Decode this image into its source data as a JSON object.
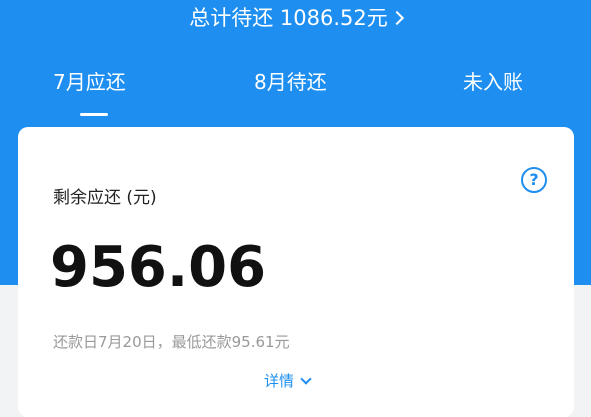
{
  "header": {
    "total_label": "总计待还",
    "total_amount": "1086.52元"
  },
  "tabs": [
    {
      "label": "7月应还",
      "active": true
    },
    {
      "label": "8月待还",
      "active": false
    },
    {
      "label": "未入账",
      "active": false
    }
  ],
  "card": {
    "label": "剩余应还 (元)",
    "help_glyph": "?",
    "amount": "956.06",
    "due_info": "还款日7月20日，最低还款95.61元",
    "details_label": "详情"
  },
  "colors": {
    "accent": "#1e8ff0",
    "card_bg": "#ffffff",
    "page_bg": "#f2f3f5"
  }
}
